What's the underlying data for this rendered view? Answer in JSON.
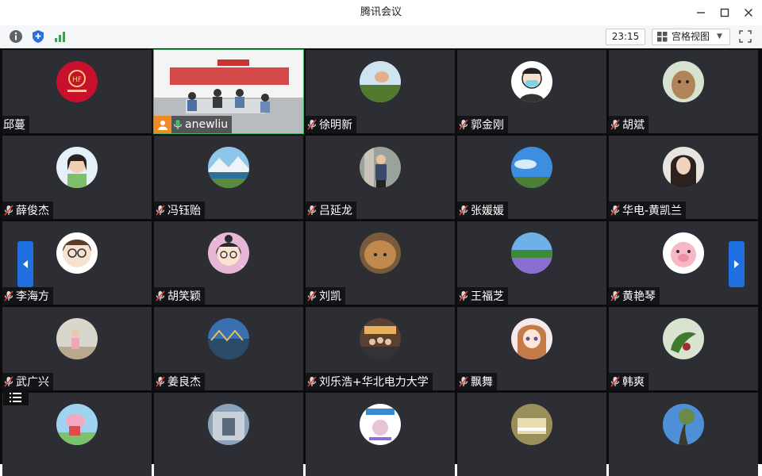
{
  "window": {
    "title": "腾讯会议"
  },
  "toolbar": {
    "timer": "23:15",
    "view_label": "宫格视图",
    "icons": [
      "info-icon",
      "shield-icon",
      "signal-icon",
      "fullscreen-icon"
    ]
  },
  "participants": [
    {
      "name": "邱蔓",
      "muted": false,
      "avatar": "red-logo"
    },
    {
      "name": "anewliu",
      "muted": false,
      "host": true,
      "video": true
    },
    {
      "name": "徐明新",
      "muted": true,
      "avatar": "hand-landscape"
    },
    {
      "name": "郭金刚",
      "muted": true,
      "avatar": "masked-cartoon"
    },
    {
      "name": "胡斌",
      "muted": true,
      "avatar": "alpaca"
    },
    {
      "name": "薛俊杰",
      "muted": true,
      "avatar": "woman-photo"
    },
    {
      "name": "冯钰贻",
      "muted": true,
      "avatar": "mountain-lake"
    },
    {
      "name": "吕延龙",
      "muted": true,
      "avatar": "man-standing"
    },
    {
      "name": "张媛媛",
      "muted": true,
      "avatar": "blue-sky"
    },
    {
      "name": "华电-黄凯兰",
      "muted": true,
      "avatar": "woman-dark"
    },
    {
      "name": "李海方",
      "muted": true,
      "avatar": "cartoon-glasses"
    },
    {
      "name": "胡笑颖",
      "muted": true,
      "avatar": "cartoon-girl"
    },
    {
      "name": "刘凯",
      "muted": true,
      "avatar": "hedgehog"
    },
    {
      "name": "王福芝",
      "muted": true,
      "avatar": "lavender-field"
    },
    {
      "name": "黄艳琴",
      "muted": true,
      "avatar": "pink-pig"
    },
    {
      "name": "武广兴",
      "muted": true,
      "avatar": "child-photo"
    },
    {
      "name": "姜良杰",
      "muted": true,
      "avatar": "city-bridge"
    },
    {
      "name": "刘乐浩+华北电力大学",
      "muted": true,
      "avatar": "group-photo"
    },
    {
      "name": "飘舞",
      "muted": true,
      "avatar": "anime-girl"
    },
    {
      "name": "韩爽",
      "muted": true,
      "avatar": "tropical"
    },
    {
      "name": "",
      "muted": true,
      "avatar": "peppa"
    },
    {
      "name": "",
      "muted": true,
      "avatar": "building"
    },
    {
      "name": "",
      "muted": true,
      "avatar": "poster"
    },
    {
      "name": "",
      "muted": true,
      "avatar": "piano"
    },
    {
      "name": "",
      "muted": true,
      "avatar": "tree-sky"
    }
  ],
  "colors": {
    "accent": "#1f6fe0",
    "host_badge": "#f08a24",
    "tile_bg": "#2c2e33",
    "active_border": "#3bb36b"
  }
}
